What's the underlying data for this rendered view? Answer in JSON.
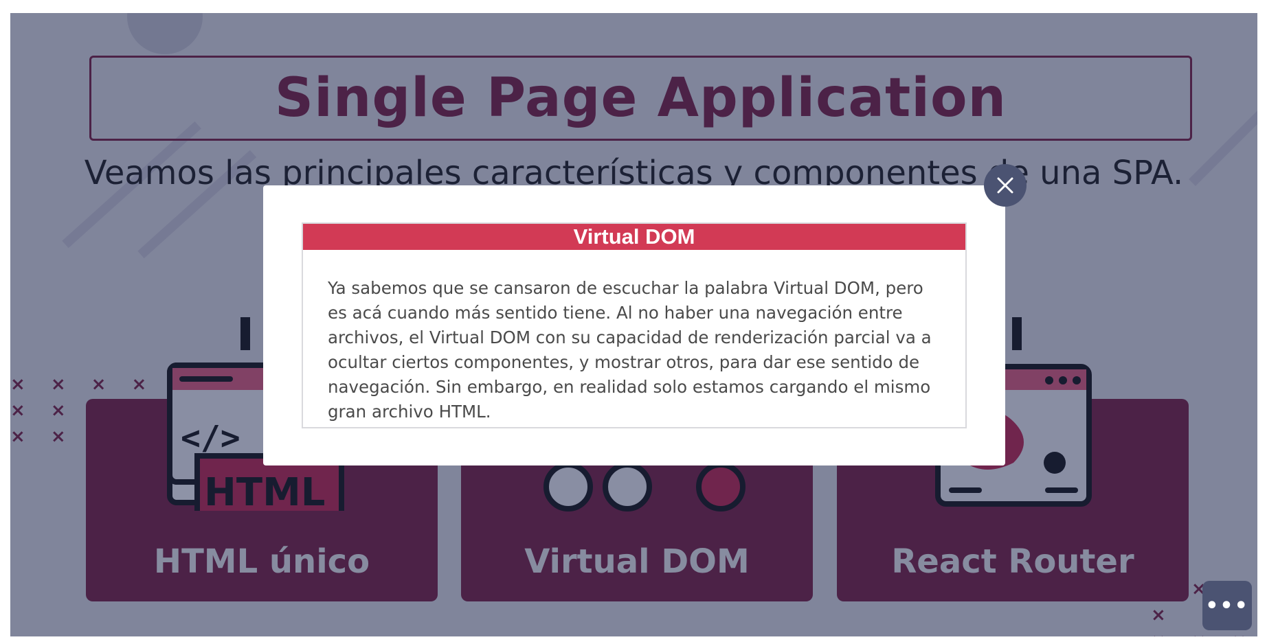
{
  "slide": {
    "title": "Single Page Application",
    "subtitle": "Veamos las principales características y componentes de una SPA."
  },
  "cards": [
    {
      "label": "HTML único",
      "icon": "html-file-icon"
    },
    {
      "label": "Virtual DOM",
      "icon": "virtual-dom-icon"
    },
    {
      "label": "React Router",
      "icon": "router-window-icon"
    }
  ],
  "illustration_text": {
    "html_tag": "HTML",
    "code_tag": "</>"
  },
  "modal": {
    "heading": "Virtual DOM",
    "body": "Ya sabemos que se cansaron de escuchar la palabra Virtual DOM, pero es acá cuando más sentido tiene. Al no haber una navegación entre archivos, el Virtual DOM con su capacidad de renderización parcial va a ocultar ciertos componentes, y mostrar otros, para dar ese sentido de navegación. Sin embargo, en realidad solo estamos cargando el mismo gran archivo HTML.",
    "close_icon": "close-icon"
  },
  "menu_button": {
    "label": "•••",
    "icon": "more-icon"
  },
  "colors": {
    "accent": "#7a1d3e",
    "modal_header": "#d23a55",
    "overlay": "#1e2850",
    "control": "#4b5372"
  }
}
